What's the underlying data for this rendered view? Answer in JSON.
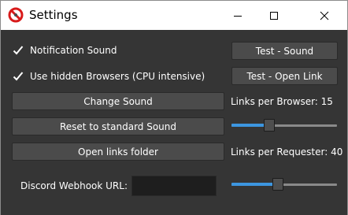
{
  "window": {
    "title": "Settings",
    "app_icon": "red-no-sign-icon",
    "controls": {
      "minimize_icon": "minimize-icon",
      "maximize_icon": "maximize-icon",
      "close_icon": "close-icon"
    }
  },
  "checkboxes": [
    {
      "label": "Notification Sound",
      "checked": true
    },
    {
      "label": "Use hidden Browsers (CPU intensive)",
      "checked": true
    }
  ],
  "buttons": {
    "test_sound": "Test - Sound",
    "test_open_link": "Test - Open Link",
    "change_sound": "Change Sound",
    "reset_sound": "Reset to standard Sound",
    "open_links_folder": "Open links folder"
  },
  "links_per_browser": {
    "label": "Links per Browser: 15",
    "value_fraction": 0.34
  },
  "links_per_requester": {
    "label": "Links per Requester: 40",
    "value_fraction": 0.43
  },
  "webhook": {
    "label": "Discord Webhook URL:",
    "value": ""
  },
  "colors": {
    "background": "#353535",
    "button": "#4b4b4b",
    "accent": "#3d96e0",
    "text": "#ffffff",
    "titlebar": "#ffffff"
  }
}
